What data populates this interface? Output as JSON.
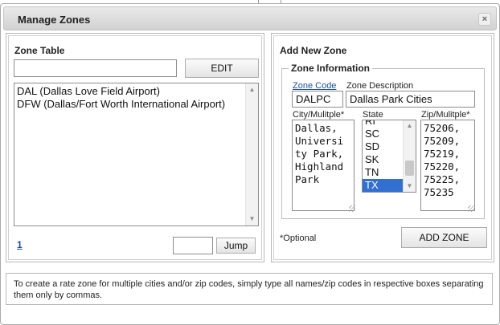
{
  "dialog": {
    "title": "Manage Zones",
    "close_glyph": "×"
  },
  "zone_table": {
    "heading": "Zone Table",
    "search_value": "",
    "edit_label": "EDIT",
    "items": [
      "DAL (Dallas Love Field Airport)",
      "DFW (Dallas/Fort Worth International Airport)"
    ],
    "page_link": "1",
    "jump_value": "",
    "jump_label": "Jump"
  },
  "add_zone": {
    "heading": "Add New Zone",
    "legend": "Zone Information",
    "zone_code_label": "Zone Code",
    "zone_code_value": "DALPC",
    "zone_desc_label": "Zone Description",
    "zone_desc_value": "Dallas Park Cities",
    "city_label": "City/Mulitple*",
    "city_value": "Dallas,\nUniversi\nty Park,\nHighland\nPark",
    "state_label": "State",
    "states": [
      "RI",
      "SC",
      "SD",
      "SK",
      "TN",
      "TX"
    ],
    "selected_state": "TX",
    "zip_label": "Zip/Mulitple*",
    "zip_value": "75206,\n75209,\n75219,\n75220,\n75225,\n75235",
    "optional_note": "*Optional",
    "add_button_label": "ADD ZONE"
  },
  "help_text": "To create a rate zone for multiple cities and/or zip codes, simply type all names/zip codes in respective boxes separating them only by commas.",
  "colors": {
    "selection": "#3170d0",
    "link": "#1a4fa5",
    "titlebar": "#d9d9d9"
  },
  "icons": {
    "close": "close-icon",
    "scroll_up": "chevron-up-icon",
    "scroll_down": "chevron-down-icon",
    "resize": "resize-grip-icon"
  }
}
